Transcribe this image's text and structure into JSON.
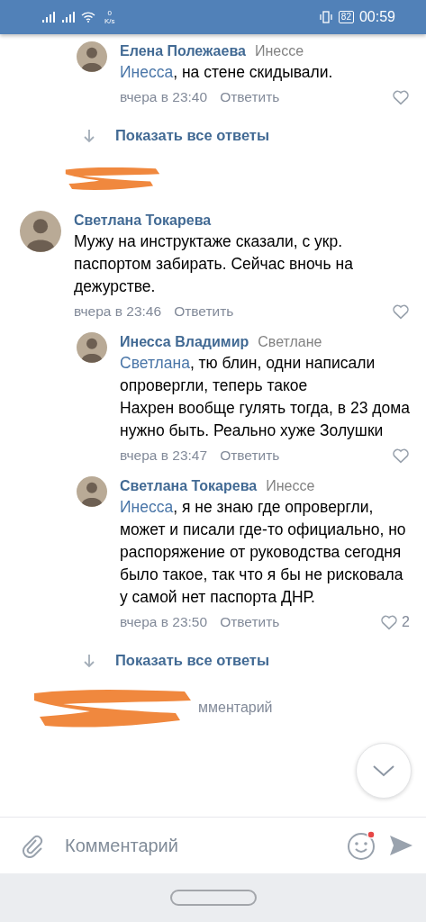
{
  "status_bar": {
    "speed_value": "0",
    "speed_unit": "K/s",
    "battery": "82",
    "time": "00:59"
  },
  "threads": [
    {
      "replies": [
        {
          "author": "Елена Полежаева",
          "reply_to": "Инессе",
          "mention": "Инесса",
          "text": ", на стене скидывали.",
          "time": "вчера в 23:40",
          "reply_label": "Ответить"
        }
      ],
      "show_more": "Показать все ответы",
      "redacted_after": true
    },
    {
      "comment": {
        "author": "Светлана Токарева",
        "text": "Мужу на инструктаже сказали, с укр. паспортом забирать. Сейчас вночь на дежурстве.",
        "time": "вчера в 23:46",
        "reply_label": "Ответить"
      },
      "replies": [
        {
          "author": "Инесса Владимир",
          "reply_to": "Светлане",
          "mention": "Светлана",
          "text": ", тю блин, одни написали опровергли, теперь такое\nНахрен вообще гулять тогда, в 23 дома нужно быть. Реально хуже Золушки",
          "time": "вчера в 23:47",
          "reply_label": "Ответить"
        },
        {
          "author": "Светлана Токарева",
          "reply_to": "Инессе",
          "mention": "Инесса",
          "text": ", я не знаю где опровергли, может и  писали где-то официально, но распоряжение от руководства сегодня было такое, так что я бы не рисковала у самой нет паспорта ДНР.",
          "time": "вчера в 23:50",
          "reply_label": "Ответить",
          "likes": "2"
        }
      ],
      "show_more": "Показать все ответы",
      "redacted_after": false
    }
  ],
  "covered_text": "мментарий",
  "composer": {
    "placeholder": "Комментарий",
    "emoji_notification": true
  }
}
